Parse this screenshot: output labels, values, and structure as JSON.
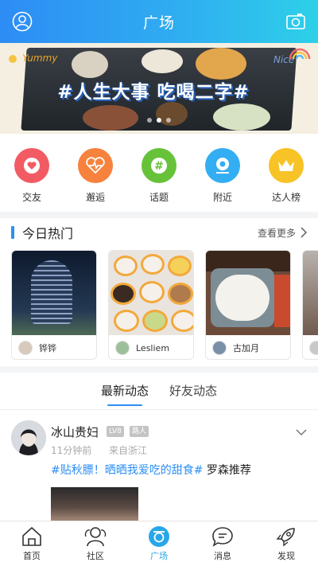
{
  "header": {
    "title": "广场",
    "left_icon": "profile-icon",
    "right_icon": "camera-icon"
  },
  "banner": {
    "slogan": "#人生大事 吃喝二字#",
    "doodle_left": "Yummy",
    "doodle_right": "Nice",
    "slide_count": 3,
    "active_slide": 2
  },
  "quick_links": [
    {
      "label": "交友",
      "icon": "heart-icon",
      "color": "#f25b64"
    },
    {
      "label": "邂逅",
      "icon": "heartbeat-icon",
      "color": "#f6823e"
    },
    {
      "label": "话题",
      "icon": "hashtag-icon",
      "color": "#67c23a"
    },
    {
      "label": "附近",
      "icon": "location-icon",
      "color": "#34aef2"
    },
    {
      "label": "达人榜",
      "icon": "crown-icon",
      "color": "#f7c326"
    }
  ],
  "hot": {
    "title": "今日热门",
    "more_label": "查看更多",
    "cards": [
      {
        "name": "铧铧",
        "photo": "night-tower-photo"
      },
      {
        "name": "Lesliem",
        "photo": "cupcakes-photo"
      },
      {
        "name": "古加月",
        "photo": "rice-lunchbox-photo"
      },
      {
        "name": "",
        "photo": "partial-photo"
      }
    ]
  },
  "feed_tabs": {
    "latest": "最新动态",
    "friends": "好友动态",
    "active": "latest"
  },
  "post": {
    "user_name": "冰山贵妇",
    "level_badge": "LV8",
    "role_badge": "路人",
    "time": "11分钟前",
    "location": "来自浙江",
    "topic": "#贴秋膘！晒晒我爱吃的甜食#",
    "text": " 罗森推荐"
  },
  "bottom_nav": [
    {
      "label": "首页",
      "icon": "home-icon"
    },
    {
      "label": "社区",
      "icon": "community-icon"
    },
    {
      "label": "广场",
      "icon": "plaza-icon",
      "active": true
    },
    {
      "label": "消息",
      "icon": "message-icon"
    },
    {
      "label": "发现",
      "icon": "rocket-icon"
    }
  ],
  "colors": {
    "primary": "#2c8ff5",
    "nav_active": "#27a7e8"
  }
}
